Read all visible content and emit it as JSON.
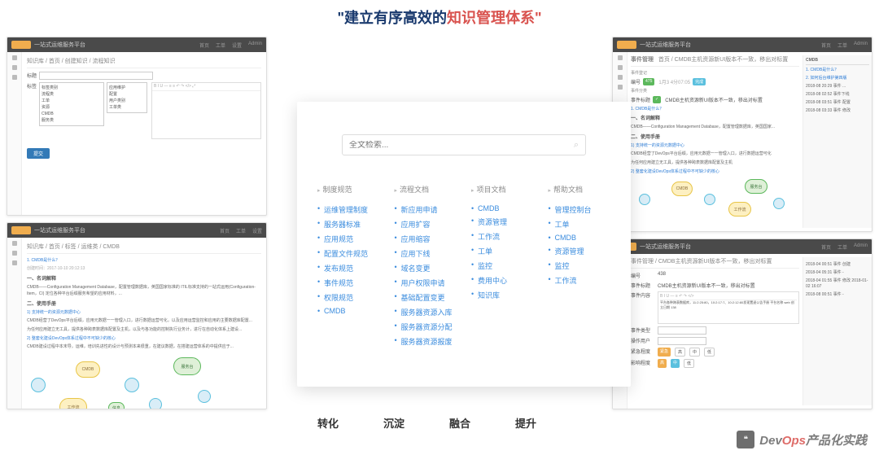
{
  "header": {
    "part1": "\"建立有序高效的",
    "part2": "知识管理体系\""
  },
  "center": {
    "search_placeholder": "全文检索...",
    "columns": [
      {
        "title": "制度规范",
        "items": [
          "运维管理制度",
          "服务器标准",
          "应用规范",
          "配置文件规范",
          "发布规范",
          "事件规范",
          "权限规范",
          "CMDB"
        ]
      },
      {
        "title": "流程文档",
        "items": [
          "新应用申请",
          "应用扩容",
          "应用缩容",
          "应用下线",
          "域名变更",
          "用户权限申请",
          "基础配置变更",
          "服务器资源入库",
          "服务器资源分配",
          "服务器资源报废"
        ]
      },
      {
        "title": "项目文档",
        "items": [
          "CMDB",
          "资源管理",
          "工作流",
          "工单",
          "监控",
          "费用中心",
          "知识库"
        ]
      },
      {
        "title": "帮助文档",
        "items": [
          "管理控制台",
          "工单",
          "CMDB",
          "资源管理",
          "监控",
          "工作流"
        ]
      }
    ]
  },
  "bottom": [
    "转化",
    "沉淀",
    "融合",
    "提升"
  ],
  "thumbs": {
    "app_title": "一站式运维服务平台",
    "nav": [
      "首页",
      "工单",
      "设置",
      "Admin"
    ],
    "tl": {
      "breadcrumb": "知识库 / 首页 / 创建知识 / 流程知识",
      "label1": "标题",
      "label2": "标签",
      "dropdown": [
        "标签类别",
        "流程类",
        "工单",
        "资源",
        "CMDB",
        "服务类"
      ],
      "dd_right": [
        "应用维护",
        "配置",
        "用户类别",
        "工单类"
      ],
      "submit": "提交"
    },
    "bl": {
      "breadcrumb": "知识库 / 首页 / 标签 / 运维类 / CMDB",
      "q": "1. CMDB是什么？",
      "date": "创建时间：2017-10-10 20:12:13",
      "h1": "一、名词解释",
      "p1": "CMDB——Configuration Management Database，配置管理数据库，英国国家标准的 ITIL标准支持的一站式运用(Configuration-Item，CI) 定位各种平台后缀服务希望的应用材料，...",
      "h2": "二、使用手册",
      "l1": "1) 支持统一的资源元数据中心",
      "p2": "CMDB经营了DevOps平台后缀，应用元数据一一管理入口，进行数据运营可化，以及应用运营监控和应用的主要数据库配置...",
      "p3": "为任何应用建立无工具，提供各种跨表数据库配置及主机，以及与各功能的控制执行业务计，进行在自动化体系上建设...",
      "l2": "2) 整套化建设DevOps体系过程中不可缺少的核心",
      "p4": "CMDB建设过程中本末导，运维，培训先进性的设计与预测本来很重，在建议数据，在搭建运营体系的中提供应于..."
    },
    "tr": {
      "title": "事件管理",
      "breadcrumb": "首页 / CMDB主机资源新UI版本不一致，移出对标置",
      "sub1": "事件登记",
      "sub2": "事件分类",
      "field_num": "编号",
      "num_val": "475",
      "date_tag": "1月3 4分07:05",
      "status": "完成",
      "field_title": "事件标题",
      "title_val": "CMDB主机资源新UI版本不一致，移出对标置",
      "q": "1. CMDB是什么？",
      "h1": "一、名词解释",
      "p1": "CMDB——Configuration Management Database，配置管理数据库，英国国家...",
      "h2": "二、使用手册",
      "l1": "1) 支持统一的资源元数据中心",
      "p2": "CMDB经营了DevOps平台后缀，应用元数据一一管理入口，进行数据运营可化",
      "p3": "为任何应用建立无工具，提供各种跨表数据库配置及主机",
      "l2": "2) 整套化建设DevOps体系过程中不可缺少的核心",
      "rp": {
        "h": "CMDB",
        "l1": "1. CMDB是什么？",
        "l2": "2. 如何后台维护第四版",
        "rows": [
          "2018-08 20:29 事件 ...",
          "2018-08 02:52 事件下线",
          "2018-08 03:51 事件 配置",
          "2018-08 03:33 事件 修改"
        ]
      }
    },
    "br": {
      "breadcrumb": "事件管理 / CMDB主机资源新UI版本不一致，移出对标置",
      "f_num": "编号",
      "num": "438",
      "f_title": "事件标题",
      "title": "CMDB主机资源新UI版本不一致，移出对标置",
      "f_content": "事件内容",
      "content": "平台各种跨表数据库，11:2:25:80，10:2:17:7、10:2:12:80发现置退公告手册\n平台名称 web\n创立日期 138",
      "f_type": "事件类型",
      "f_user": "操作用户",
      "f_level": "紧急程度",
      "tags": [
        "紧急",
        "高",
        "中",
        "低"
      ],
      "f_affect": "影响程度",
      "tags2": [
        "高",
        "中",
        "低"
      ],
      "rp_rows": [
        "2018-04 00:51 事件 创建",
        "2018-04 05:31 事件 -",
        "2018-04 01:55 事件 修改  2018-01-02 16:07",
        "2018-08 00:51 事件 -"
      ]
    }
  },
  "watermark": {
    "icon": "❝",
    "brand1": "Dev",
    "brand2": "Ops",
    "text": "产品化实践"
  }
}
